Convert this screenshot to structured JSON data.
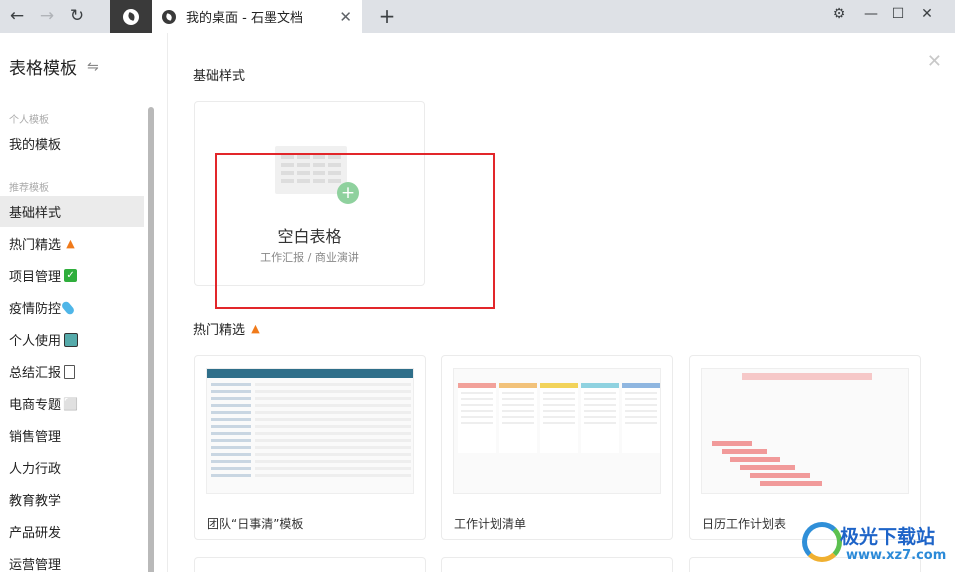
{
  "browser": {
    "tab_title": "我的桌面 - 石墨文档",
    "nav": {
      "back": "←",
      "forward": "→",
      "reload": "↻"
    },
    "tab_close": "✕",
    "new_tab": "+",
    "window": {
      "settings": "⚙",
      "minimize": "—",
      "maximize": "☐",
      "close": "✕"
    }
  },
  "sidebar": {
    "title": "表格模板",
    "swap_icon": "⇋",
    "sections": {
      "personal": "个人模板",
      "recommended": "推荐模板"
    },
    "personal_items": [
      {
        "label": "我的模板"
      }
    ],
    "items": [
      {
        "label": "基础样式",
        "emoji": ""
      },
      {
        "label": "热门精选",
        "emoji": "fire"
      },
      {
        "label": "项目管理",
        "emoji": "check"
      },
      {
        "label": "疫情防控",
        "emoji": "pill"
      },
      {
        "label": "个人使用",
        "emoji": "calendar"
      },
      {
        "label": "总结汇报",
        "emoji": "document"
      },
      {
        "label": "电商专题",
        "emoji": "cart"
      },
      {
        "label": "销售管理",
        "emoji": ""
      },
      {
        "label": "人力行政",
        "emoji": ""
      },
      {
        "label": "教育教学",
        "emoji": ""
      },
      {
        "label": "产品研发",
        "emoji": ""
      },
      {
        "label": "运营管理",
        "emoji": ""
      }
    ]
  },
  "main": {
    "close": "✕",
    "basic_section": "基础样式",
    "blank": {
      "title": "空白表格",
      "subtitle": "工作汇报 / 商业演讲",
      "plus": "+"
    },
    "hot_section": "热门精选",
    "templates": [
      {
        "label": "团队“日事清”模板"
      },
      {
        "label": "工作计划清单"
      },
      {
        "label": "日历工作计划表"
      }
    ]
  },
  "watermark": {
    "brand": "极光下载站",
    "url": "www.xz7.com"
  },
  "colors": {
    "highlight": "#e2262a",
    "active_bg": "#ebebeb",
    "plus": "#8fd19e"
  }
}
